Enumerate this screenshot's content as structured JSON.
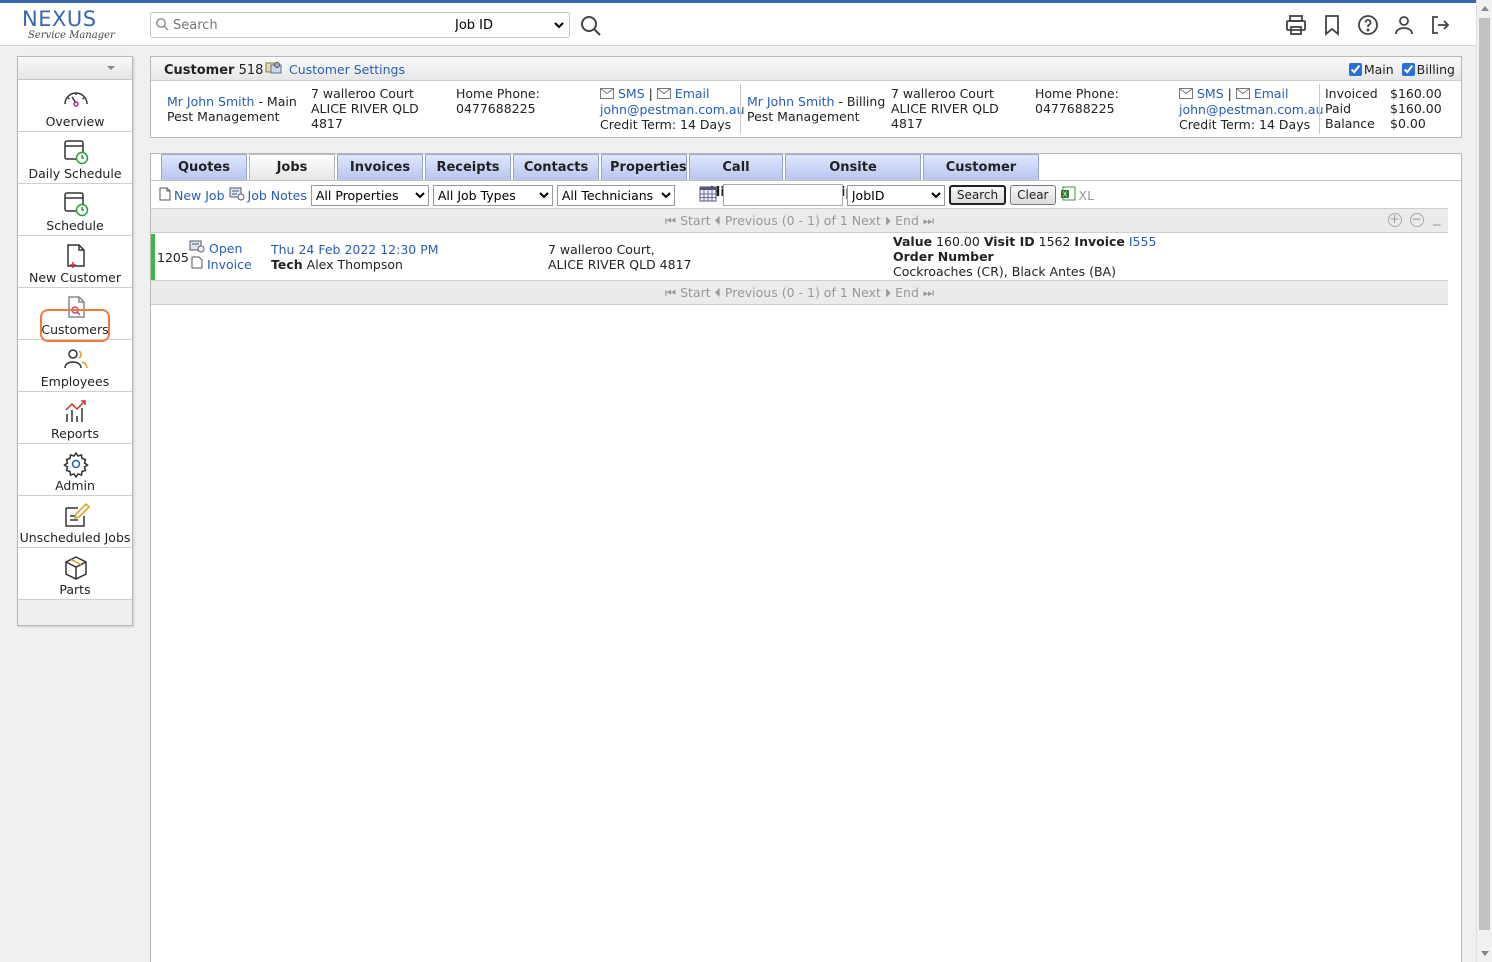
{
  "header": {
    "logo_main": "NEXUS",
    "logo_sub": "Service Manager",
    "search_placeholder": "Search",
    "search_type_selected": "Job ID"
  },
  "sidebar": {
    "items": [
      {
        "label": "Overview",
        "icon": "speedometer-icon"
      },
      {
        "label": "Daily Schedule",
        "icon": "calendar-clock-icon"
      },
      {
        "label": "Schedule",
        "icon": "calendar-clock-icon"
      },
      {
        "label": "New Customer",
        "icon": "new-document-icon"
      },
      {
        "label": "Customers",
        "icon": "document-search-icon"
      },
      {
        "label": "Employees",
        "icon": "users-icon"
      },
      {
        "label": "Reports",
        "icon": "chart-icon"
      },
      {
        "label": "Admin",
        "icon": "gear-icon"
      },
      {
        "label": "Unscheduled Jobs",
        "icon": "edit-icon"
      },
      {
        "label": "Parts",
        "icon": "box-icon"
      }
    ]
  },
  "customer": {
    "title_label": "Customer",
    "number": "518",
    "settings_label": "Customer Settings",
    "checks": {
      "main": "Main",
      "billing": "Billing"
    },
    "main": {
      "name": "Mr John Smith",
      "role_suffix": "- Main",
      "company": "Pest Management",
      "address1": "7 walleroo Court",
      "address2": "ALICE RIVER QLD",
      "address3": "4817",
      "phone_label": "Home Phone:",
      "phone": "0477688225",
      "sms": "SMS",
      "sep": "|",
      "email_label": "Email",
      "email": "john@pestman.com.au",
      "credit": "Credit Term: 14 Days"
    },
    "billing": {
      "name": "Mr John Smith",
      "role_suffix": "- Billing",
      "company": "Pest Management",
      "address1": "7 walleroo Court",
      "address2": "ALICE RIVER QLD",
      "address3": "4817",
      "phone_label": "Home Phone:",
      "phone": "0477688225",
      "sms": "SMS",
      "sep": "|",
      "email_label": "Email",
      "email": "john@pestman.com.au",
      "credit": "Credit Term: 14 Days"
    },
    "totals": {
      "invoiced_label": "Invoiced",
      "invoiced": "$160.00",
      "paid_label": "Paid",
      "paid": "$160.00",
      "balance_label": "Balance",
      "balance": "$0.00"
    }
  },
  "tabs": [
    "Quotes",
    "Jobs",
    "Invoices",
    "Receipts",
    "Contacts",
    "Properties",
    "Call History",
    "Onsite Equipment",
    "Customer Files"
  ],
  "active_tab": "Jobs",
  "toolbar": {
    "new_job": "New Job",
    "job_notes": "Job Notes",
    "properties_selected": "All Properties",
    "job_types_selected": "All Job Types",
    "technicians_selected": "All Technicians",
    "field_selected": "JobID",
    "search_btn": "Search",
    "clear_btn": "Clear",
    "xl": "XL"
  },
  "pager": {
    "start": "Start",
    "previous": "Previous",
    "range": "(0 - 1) of 1",
    "next": "Next",
    "end": "End"
  },
  "jobs": [
    {
      "id": "1205",
      "open": "Open",
      "invoice": "Invoice",
      "date": "Thu 24 Feb 2022 12:30 PM",
      "tech_label": "Tech",
      "tech": "Alex Thompson",
      "address1": "7 walleroo Court,",
      "address2": "ALICE RIVER QLD 4817",
      "value_label": "Value",
      "value": "160.00",
      "visit_label": "Visit ID",
      "visit_id": "1562",
      "invoice_label": "Invoice",
      "invoice_no": "I555",
      "order_label": "Order Number",
      "pests": "Cockroaches (CR), Black Antes (BA)"
    }
  ]
}
